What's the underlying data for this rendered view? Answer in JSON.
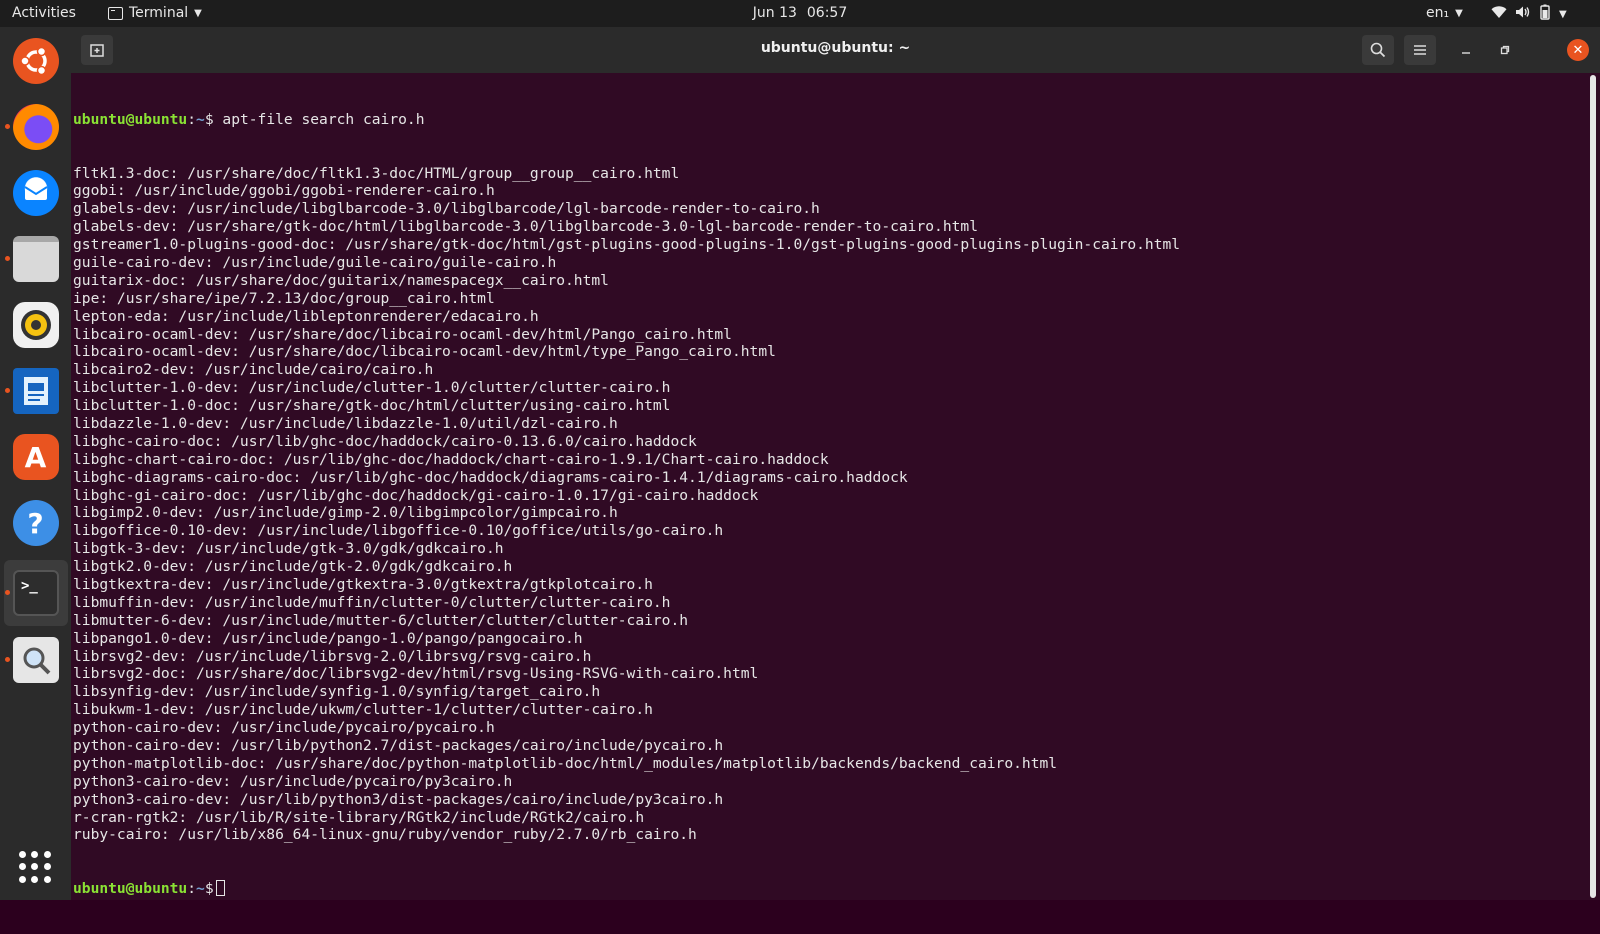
{
  "topbar": {
    "activities": "Activities",
    "app_menu": "Terminal",
    "date": "Jun 13",
    "time": "06:57",
    "lang": "en₁",
    "icons": [
      "wifi-icon",
      "volume-icon",
      "battery-icon",
      "system-menu-caret"
    ]
  },
  "dock": {
    "items": [
      {
        "name": "ubuntu-logo",
        "running": false
      },
      {
        "name": "firefox",
        "running": true
      },
      {
        "name": "thunderbird",
        "running": false
      },
      {
        "name": "files",
        "running": true
      },
      {
        "name": "rhythmbox",
        "running": false
      },
      {
        "name": "libreoffice-writer",
        "running": true
      },
      {
        "name": "ubuntu-software",
        "running": false
      },
      {
        "name": "help",
        "running": false
      },
      {
        "name": "terminal",
        "running": true,
        "active": true
      },
      {
        "name": "image-viewer",
        "running": true
      }
    ],
    "show_apps": "show-applications-icon"
  },
  "window": {
    "title": "ubuntu@ubuntu: ~"
  },
  "terminal": {
    "prompt_user": "ubuntu@ubuntu",
    "prompt_sep": ":",
    "prompt_path": "~",
    "prompt_symbol": "$",
    "command": " apt-file search cairo.h",
    "output": [
      "fltk1.3-doc: /usr/share/doc/fltk1.3-doc/HTML/group__group__cairo.html",
      "ggobi: /usr/include/ggobi/ggobi-renderer-cairo.h",
      "glabels-dev: /usr/include/libglbarcode-3.0/libglbarcode/lgl-barcode-render-to-cairo.h",
      "glabels-dev: /usr/share/gtk-doc/html/libglbarcode-3.0/libglbarcode-3.0-lgl-barcode-render-to-cairo.html",
      "gstreamer1.0-plugins-good-doc: /usr/share/gtk-doc/html/gst-plugins-good-plugins-1.0/gst-plugins-good-plugins-plugin-cairo.html",
      "guile-cairo-dev: /usr/include/guile-cairo/guile-cairo.h",
      "guitarix-doc: /usr/share/doc/guitarix/namespacegx__cairo.html",
      "ipe: /usr/share/ipe/7.2.13/doc/group__cairo.html",
      "lepton-eda: /usr/include/libleptonrenderer/edacairo.h",
      "libcairo-ocaml-dev: /usr/share/doc/libcairo-ocaml-dev/html/Pango_cairo.html",
      "libcairo-ocaml-dev: /usr/share/doc/libcairo-ocaml-dev/html/type_Pango_cairo.html",
      "libcairo2-dev: /usr/include/cairo/cairo.h",
      "libclutter-1.0-dev: /usr/include/clutter-1.0/clutter/clutter-cairo.h",
      "libclutter-1.0-doc: /usr/share/gtk-doc/html/clutter/using-cairo.html",
      "libdazzle-1.0-dev: /usr/include/libdazzle-1.0/util/dzl-cairo.h",
      "libghc-cairo-doc: /usr/lib/ghc-doc/haddock/cairo-0.13.6.0/cairo.haddock",
      "libghc-chart-cairo-doc: /usr/lib/ghc-doc/haddock/chart-cairo-1.9.1/Chart-cairo.haddock",
      "libghc-diagrams-cairo-doc: /usr/lib/ghc-doc/haddock/diagrams-cairo-1.4.1/diagrams-cairo.haddock",
      "libghc-gi-cairo-doc: /usr/lib/ghc-doc/haddock/gi-cairo-1.0.17/gi-cairo.haddock",
      "libgimp2.0-dev: /usr/include/gimp-2.0/libgimpcolor/gimpcairo.h",
      "libgoffice-0.10-dev: /usr/include/libgoffice-0.10/goffice/utils/go-cairo.h",
      "libgtk-3-dev: /usr/include/gtk-3.0/gdk/gdkcairo.h",
      "libgtk2.0-dev: /usr/include/gtk-2.0/gdk/gdkcairo.h",
      "libgtkextra-dev: /usr/include/gtkextra-3.0/gtkextra/gtkplotcairo.h",
      "libmuffin-dev: /usr/include/muffin/clutter-0/clutter/clutter-cairo.h",
      "libmutter-6-dev: /usr/include/mutter-6/clutter/clutter/clutter-cairo.h",
      "libpango1.0-dev: /usr/include/pango-1.0/pango/pangocairo.h",
      "librsvg2-dev: /usr/include/librsvg-2.0/librsvg/rsvg-cairo.h",
      "librsvg2-doc: /usr/share/doc/librsvg2-dev/html/rsvg-Using-RSVG-with-cairo.html",
      "libsynfig-dev: /usr/include/synfig-1.0/synfig/target_cairo.h",
      "libukwm-1-dev: /usr/include/ukwm/clutter-1/clutter/clutter-cairo.h",
      "python-cairo-dev: /usr/include/pycairo/pycairo.h",
      "python-cairo-dev: /usr/lib/python2.7/dist-packages/cairo/include/pycairo.h",
      "python-matplotlib-doc: /usr/share/doc/python-matplotlib-doc/html/_modules/matplotlib/backends/backend_cairo.html",
      "python3-cairo-dev: /usr/include/pycairo/py3cairo.h",
      "python3-cairo-dev: /usr/lib/python3/dist-packages/cairo/include/py3cairo.h",
      "r-cran-rgtk2: /usr/lib/R/site-library/RGtk2/include/RGtk2/cairo.h",
      "ruby-cairo: /usr/lib/x86_64-linux-gnu/ruby/vendor_ruby/2.7.0/rb_cairo.h"
    ]
  }
}
